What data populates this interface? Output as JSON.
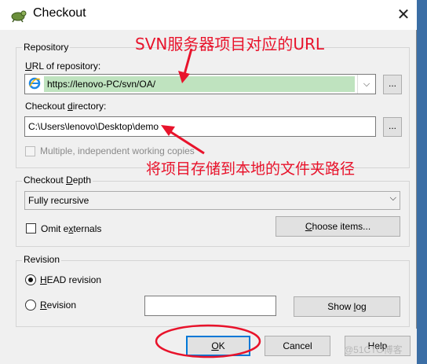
{
  "window": {
    "title": "Checkout"
  },
  "repository": {
    "group_label": "Repository",
    "url_label": "URL of repository:",
    "url_value": "https://lenovo-PC/svn/OA/",
    "dir_label": "Checkout directory:",
    "dir_value": "C:\\Users\\lenovo\\Desktop\\demo",
    "browse_label": "...",
    "multiple_label": "Multiple, independent working copies"
  },
  "depth": {
    "group_label": "Checkout Depth",
    "selected": "Fully recursive",
    "omit_label": "Omit externals",
    "choose_label": "Choose items..."
  },
  "revision": {
    "group_label": "Revision",
    "head_label": "HEAD revision",
    "revision_label": "Revision",
    "showlog_label": "Show log"
  },
  "buttons": {
    "ok": "OK",
    "cancel": "Cancel",
    "help": "Help"
  },
  "annotations": {
    "url_note": "SVN服务器项目对应的URL",
    "dir_note": "将项目存储到本地的文件夹路径",
    "color": "#e8132b"
  },
  "watermark": "@51CTO博客"
}
